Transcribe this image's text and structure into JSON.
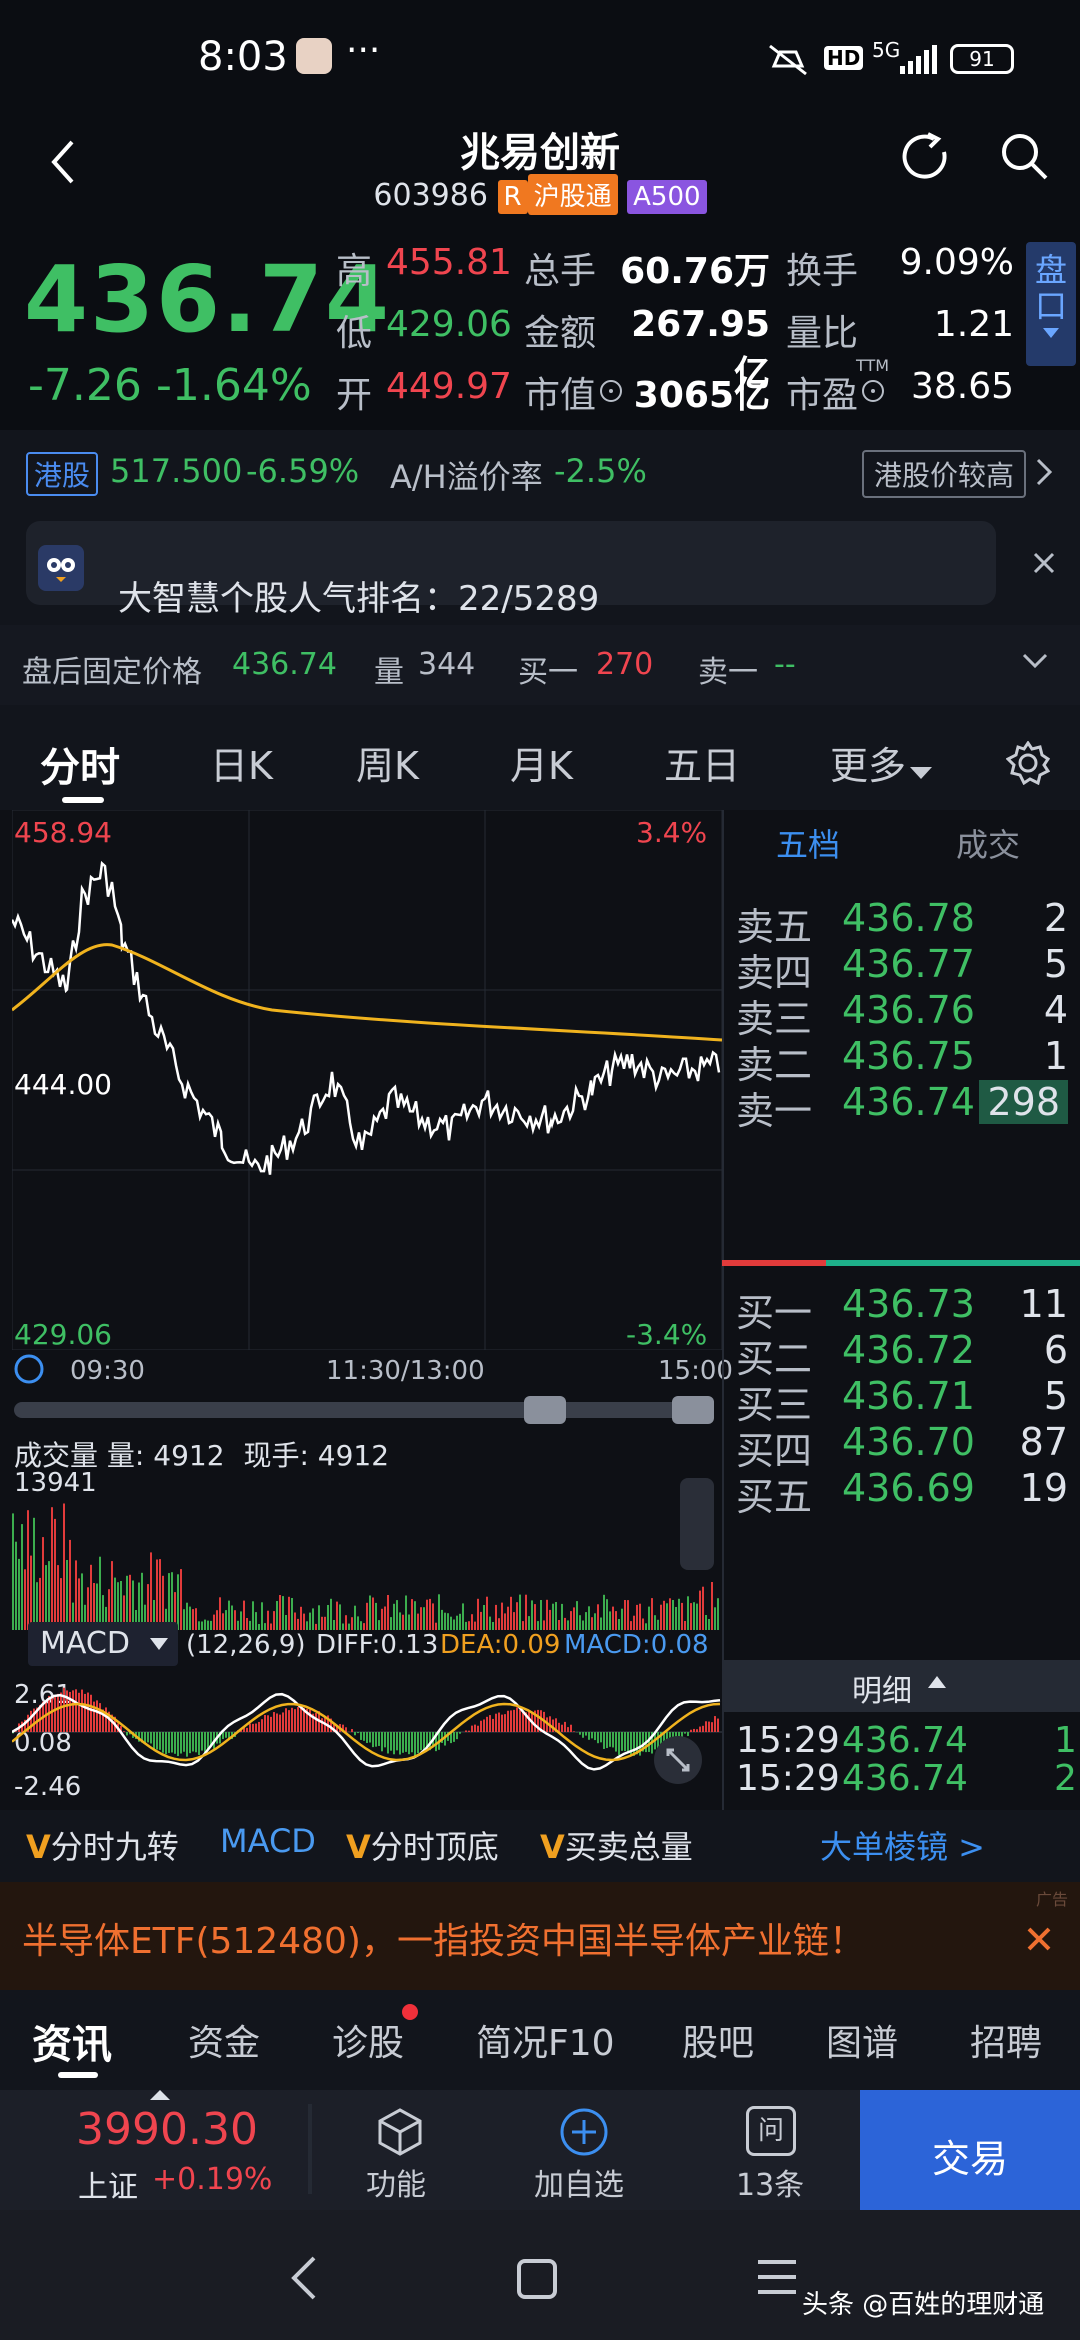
{
  "status": {
    "time": "8:03",
    "more": "···",
    "hd": "HD",
    "net": "5G",
    "battery": "91"
  },
  "header": {
    "title": "兆易创新",
    "code": "603986",
    "tag_r": "R",
    "tag_hgt": "沪股通",
    "tag_a500": "A500"
  },
  "quote": {
    "price": "436.74",
    "change": "-7.26",
    "change_pct": "-1.64%",
    "high_label": "高",
    "high": "455.81",
    "low_label": "低",
    "low": "429.06",
    "open_label": "开",
    "open": "449.97",
    "vol_label": "总手",
    "vol": "60.76万",
    "amt_label": "金额",
    "amt": "267.95亿",
    "mcap_label": "市值",
    "mcap": "3065亿",
    "turn_label": "换手",
    "turn": "9.09%",
    "vr_label": "量比",
    "vr": "1.21",
    "pe_label": "市盈",
    "pe_sup": "TTM",
    "pe": "38.65",
    "side_label": "盘口"
  },
  "hk": {
    "tag": "港股",
    "price": "517.500",
    "pct": "-6.59%",
    "ah_label": "A/H溢价率",
    "ah": "-2.5%",
    "btn": "港股价较高"
  },
  "announcement": {
    "text": "大智慧个股人气排名：22/5289"
  },
  "afterhours": {
    "label": "盘后固定价格",
    "price": "436.74",
    "vol_label": "量",
    "vol": "344",
    "bid_label": "买一",
    "bid": "270",
    "ask_label": "卖一",
    "ask": "--"
  },
  "period_tabs": [
    "分时",
    "日K",
    "周K",
    "月K",
    "五日",
    "更多"
  ],
  "intraday": {
    "max": "458.94",
    "max_pct": "3.4%",
    "mid": "444.00",
    "min": "429.06",
    "min_pct": "-3.4%",
    "times": [
      "09:30",
      "11:30/13:00",
      "15:00"
    ],
    "colors": {
      "price": "#ffffff",
      "avg": "#f0b31e",
      "up": "#e23b3b",
      "down": "#3cae4e"
    }
  },
  "orderbook": {
    "tabs": [
      "五档",
      "成交"
    ],
    "asks": [
      {
        "label": "卖五",
        "price": "436.78",
        "qty": "2"
      },
      {
        "label": "卖四",
        "price": "436.77",
        "qty": "5"
      },
      {
        "label": "卖三",
        "price": "436.76",
        "qty": "4"
      },
      {
        "label": "卖二",
        "price": "436.75",
        "qty": "1"
      },
      {
        "label": "卖一",
        "price": "436.74",
        "qty": "298"
      }
    ],
    "bids": [
      {
        "label": "买一",
        "price": "436.73",
        "qty": "11"
      },
      {
        "label": "买二",
        "price": "436.72",
        "qty": "6"
      },
      {
        "label": "买三",
        "price": "436.71",
        "qty": "5"
      },
      {
        "label": "买四",
        "price": "436.70",
        "qty": "87"
      },
      {
        "label": "买五",
        "price": "436.69",
        "qty": "19"
      }
    ],
    "detail_label": "明细",
    "ticks": [
      {
        "time": "15:29",
        "price": "436.74",
        "qty": "1"
      },
      {
        "time": "15:29",
        "price": "436.74",
        "qty": "2"
      }
    ]
  },
  "volume": {
    "title": "成交量",
    "vol_label": "量:",
    "vol": "4912",
    "cur_label": "现手:",
    "cur": "4912",
    "max": "13941"
  },
  "macd": {
    "name": "MACD",
    "params": "(12,26,9)",
    "diff": "DIFF:0.13",
    "dea": "DEA:0.09",
    "macd": "MACD:0.08",
    "top": "2.61",
    "mid": "0.08",
    "bot": "-2.46"
  },
  "indicator_tabs": [
    {
      "v": "V",
      "label": "分时九转"
    },
    {
      "v": "",
      "label": "MACD"
    },
    {
      "v": "V",
      "label": "分时顶底"
    },
    {
      "v": "V",
      "label": "买卖总量"
    }
  ],
  "big_order": "大单棱镜 >",
  "ad": {
    "text": "半导体ETF(512480)，一指投资中国半导体产业链！",
    "tag": "广告"
  },
  "bottom_tabs": [
    "资讯",
    "资金",
    "诊股",
    "简况F10",
    "股吧",
    "图谱",
    "招聘"
  ],
  "dock": {
    "index_value": "3990.30",
    "index_name": "上证",
    "index_pct": "+0.19%",
    "func": "功能",
    "add": "加自选",
    "msg_count": "13条",
    "msg_icon": "问",
    "trade": "交易"
  },
  "watermark": "头条 @百姓的理财通"
}
